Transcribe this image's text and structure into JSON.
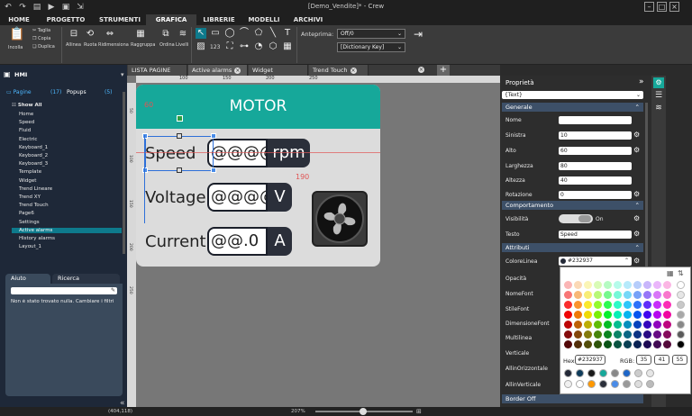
{
  "app": {
    "title": "[Demo_Vendite]* - Crew"
  },
  "menu": {
    "tabs": [
      "HOME",
      "PROGETTO",
      "STRUMENTI",
      "GRAFICA",
      "LIBRERIE",
      "MODELLI",
      "ARCHIVI"
    ],
    "active": "GRAFICA"
  },
  "ribbon": {
    "paste_label": "Incolla",
    "cut_label": "Taglia",
    "copy_label": "Copia",
    "duplicate_label": "Duplica",
    "align_label": "Allinea",
    "rotate_label": "Ruota",
    "resize_label": "Ridimensiona",
    "group_label": "Raggruppa",
    "order_label": "Ordina",
    "levels_label": "Livelli",
    "preview_label": "Anteprima:",
    "preview_value": "Off/0",
    "dictionary_value": "[Dictionary Key]",
    "number_icon_text": "123"
  },
  "left": {
    "project_name": "HMI",
    "pages_label": "Pagine",
    "pages_count": "(17)",
    "popups_label": "Popups",
    "popups_count": "(5)",
    "show_all": "Show All",
    "pages": [
      "Home",
      "Speed",
      "Fluid",
      "Electric",
      "Keyboard_1",
      "Keyboard_2",
      "Keyboard_3",
      "Template",
      "Widget",
      "Trend Lineare",
      "Trend XY",
      "Trend Touch",
      "Page6",
      "Settings",
      "Active alarms",
      "History alarms",
      "Layout_1"
    ],
    "selected_page": "Active alarms",
    "help_tab": "Aiuto",
    "search_tab": "Ricerca",
    "help_message": "Non è stato trovato nulla. Cambiare i filtri"
  },
  "doc_tabs": [
    "LISTA PAGINE",
    "Active alarms",
    "Widget",
    "Trend Touch"
  ],
  "canvas": {
    "ruler_marks": [
      "100",
      "150",
      "200",
      "250"
    ],
    "ruler_v_marks": [
      "50",
      "100",
      "150",
      "200",
      "250"
    ],
    "page_title": "MOTOR",
    "rows": [
      {
        "label": "Speed",
        "value": "@@@@",
        "unit": "rpm"
      },
      {
        "label": "Voltage",
        "value": "@@@@",
        "unit": "V"
      },
      {
        "label": "Current",
        "value": "@@.0",
        "unit": "A"
      }
    ],
    "selection_left": "60",
    "selection_top": "190"
  },
  "props": {
    "header": "Proprietà",
    "object_type": "{Text}",
    "sections": [
      "Generale",
      "Comportamento",
      "Attributi",
      "Border Off"
    ],
    "fields": {
      "name": {
        "label": "Nome",
        "value": ""
      },
      "left": {
        "label": "Sinistra",
        "value": "10"
      },
      "top": {
        "label": "Alto",
        "value": "60"
      },
      "width": {
        "label": "Larghezza",
        "value": "80"
      },
      "height": {
        "label": "Altezza",
        "value": "40"
      },
      "rotation": {
        "label": "Rotazione",
        "value": "0"
      },
      "visibility": {
        "label": "Visibilità",
        "value": "On"
      },
      "text": {
        "label": "Testo",
        "value": "Speed"
      },
      "line_color": {
        "label": "ColoreLinea",
        "value": "#232937"
      }
    },
    "attr_labels": [
      "Opacità",
      "NomeFont",
      "StileFont",
      "DimensioneFont",
      "Multilinea",
      "Verticale",
      "AllinOrizzontale",
      "AllinVerticale"
    ]
  },
  "picker": {
    "hex_label": "Hex:",
    "hex_value": "#232937",
    "rgb_label": "RGB:",
    "r": "35",
    "g": "41",
    "b": "55"
  },
  "status": {
    "coords": "(404,118)",
    "zoom": "207%"
  },
  "colors": {
    "accent": "#16a89a",
    "selected": "#0e7a8c",
    "line_color": "#232937"
  }
}
